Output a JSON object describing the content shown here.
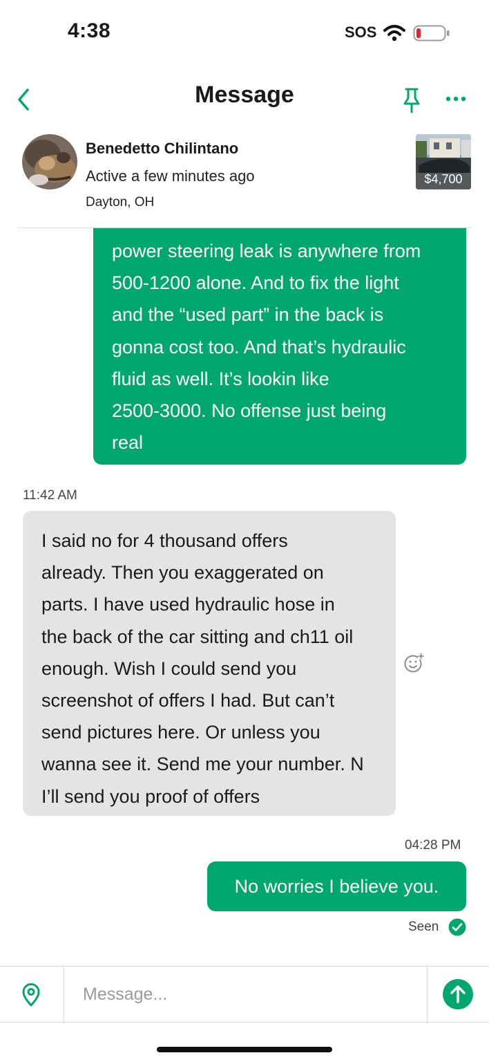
{
  "status_bar": {
    "time": "4:38",
    "carrier": "SOS"
  },
  "header": {
    "title": "Message"
  },
  "contact": {
    "name": "Benedetto Chilintano",
    "status": "Active a few minutes ago",
    "location": "Dayton, OH"
  },
  "listing": {
    "price": "$4,700"
  },
  "messages": [
    {
      "direction": "outgoing",
      "lines": [
        "power steering leak is anywhere from",
        "500-1200 alone. And to fix the light",
        "and the “used part” in the back is",
        "gonna cost too. And that’s hydraulic",
        "fluid as well. It’s lookin like",
        "2500-3000. No offense just being",
        "real"
      ]
    },
    {
      "direction": "incoming",
      "time": "11:42 AM",
      "lines": [
        "I said no for 4 thousand offers",
        "already. Then you exaggerated on",
        "parts. I have used hydraulic hose in",
        "the back of the car sitting and ch11 oil",
        "enough. Wish I could send you",
        "screenshot of offers I had. But can’t",
        "send pictures here. Or unless you",
        "wanna see it. Send me your number. N",
        "I’ll send you proof of offers"
      ]
    },
    {
      "direction": "outgoing",
      "time": "04:28 PM",
      "text": "No worries I believe you.",
      "receipt": "Seen"
    }
  ],
  "composer": {
    "placeholder": "Message..."
  },
  "colors": {
    "accent": "#02a76e",
    "incoming_bubble": "#e4e4e4"
  },
  "icons": {
    "back": "chevron-left-icon",
    "pin": "pin-icon",
    "more": "more-dots-icon",
    "react": "add-reaction-icon",
    "seen": "check-circle-icon",
    "location": "location-pin-icon",
    "send": "arrow-up-icon"
  }
}
